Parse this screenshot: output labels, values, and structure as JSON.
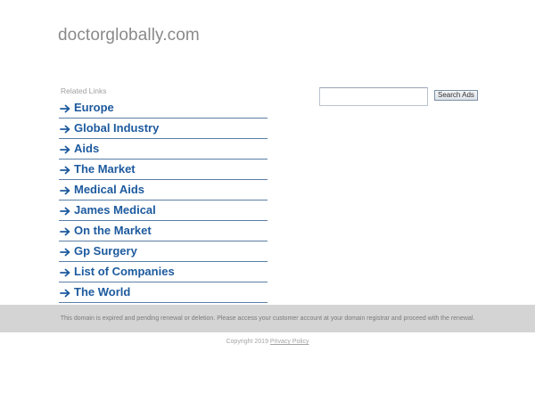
{
  "site": {
    "title": "doctorglobally.com"
  },
  "related": {
    "heading": "Related Links",
    "arrow_icon": "arrow-right-icon",
    "link_color": "#1d5a9e",
    "items": [
      {
        "label": "Europe"
      },
      {
        "label": "Global Industry"
      },
      {
        "label": "Aids"
      },
      {
        "label": "The Market"
      },
      {
        "label": "Medical Aids"
      },
      {
        "label": "James Medical"
      },
      {
        "label": "On the Market"
      },
      {
        "label": "Gp Surgery"
      },
      {
        "label": "List of Companies"
      },
      {
        "label": "The World"
      }
    ]
  },
  "search": {
    "value": "",
    "button_label": "Search Ads"
  },
  "notice": {
    "text": "This domain is expired and pending renewal or deletion. Please access your customer account at your domain registrar and proceed with the renewal.",
    "background": "#d4d4d4"
  },
  "footer": {
    "copyright": "Copyright 2019",
    "privacy_label": "Privacy Policy"
  }
}
